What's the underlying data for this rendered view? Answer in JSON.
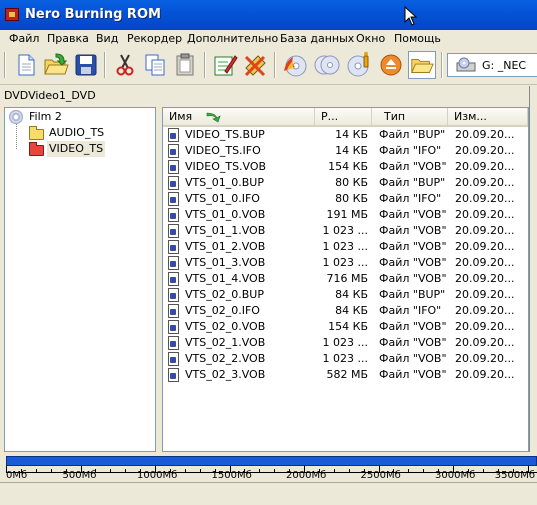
{
  "window": {
    "title": "Nero Burning ROM"
  },
  "menu": [
    "Файл",
    "Правка",
    "Вид",
    "Рекордер",
    "Дополнительно",
    "База данных",
    "Окно",
    "Помощь"
  ],
  "toolbar": {
    "buttons": [
      "new-document-icon",
      "open-icon",
      "save-icon",
      "cut-icon",
      "copy-icon",
      "paste-icon",
      "compilation-properties-icon",
      "erase-icon",
      "burn-icon",
      "copy-disc-icon",
      "disc-info-icon",
      "eject-icon",
      "open-folder-icon"
    ],
    "drive": {
      "label": "G: _NEC"
    }
  },
  "compilation": {
    "name": "DVDVideo1_DVD"
  },
  "tree": {
    "root": "Film 2",
    "children": [
      "AUDIO_TS",
      "VIDEO_TS"
    ]
  },
  "list": {
    "columns": [
      "Имя",
      "Р...",
      "Тип",
      "Изм..."
    ],
    "rows": [
      {
        "name": "VIDEO_TS.BUP",
        "size": "14 КБ",
        "type": "Файл \"BUP\"",
        "modified": "20.09.20..."
      },
      {
        "name": "VIDEO_TS.IFO",
        "size": "14 КБ",
        "type": "Файл \"IFO\"",
        "modified": "20.09.20..."
      },
      {
        "name": "VIDEO_TS.VOB",
        "size": "154 КБ",
        "type": "Файл \"VOB\"",
        "modified": "20.09.20..."
      },
      {
        "name": "VTS_01_0.BUP",
        "size": "80 КБ",
        "type": "Файл \"BUP\"",
        "modified": "20.09.20..."
      },
      {
        "name": "VTS_01_0.IFO",
        "size": "80 КБ",
        "type": "Файл \"IFO\"",
        "modified": "20.09.20..."
      },
      {
        "name": "VTS_01_0.VOB",
        "size": "191 МБ",
        "type": "Файл \"VOB\"",
        "modified": "20.09.20..."
      },
      {
        "name": "VTS_01_1.VOB",
        "size": "1 023 ...",
        "type": "Файл \"VOB\"",
        "modified": "20.09.20..."
      },
      {
        "name": "VTS_01_2.VOB",
        "size": "1 023 ...",
        "type": "Файл \"VOB\"",
        "modified": "20.09.20..."
      },
      {
        "name": "VTS_01_3.VOB",
        "size": "1 023 ...",
        "type": "Файл \"VOB\"",
        "modified": "20.09.20..."
      },
      {
        "name": "VTS_01_4.VOB",
        "size": "716 МБ",
        "type": "Файл \"VOB\"",
        "modified": "20.09.20..."
      },
      {
        "name": "VTS_02_0.BUP",
        "size": "84 КБ",
        "type": "Файл \"BUP\"",
        "modified": "20.09.20..."
      },
      {
        "name": "VTS_02_0.IFO",
        "size": "84 КБ",
        "type": "Файл \"IFO\"",
        "modified": "20.09.20..."
      },
      {
        "name": "VTS_02_0.VOB",
        "size": "154 КБ",
        "type": "Файл \"VOB\"",
        "modified": "20.09.20..."
      },
      {
        "name": "VTS_02_1.VOB",
        "size": "1 023 ...",
        "type": "Файл \"VOB\"",
        "modified": "20.09.20..."
      },
      {
        "name": "VTS_02_2.VOB",
        "size": "1 023 ...",
        "type": "Файл \"VOB\"",
        "modified": "20.09.20..."
      },
      {
        "name": "VTS_02_3.VOB",
        "size": "582 МБ",
        "type": "Файл \"VOB\"",
        "modified": "20.09.20..."
      }
    ]
  },
  "capacity": {
    "labels": [
      "0Мб",
      "500Мб",
      "1000Мб",
      "1500Мб",
      "2000Мб",
      "2500Мб",
      "3000Мб",
      "3500Мб"
    ]
  },
  "colors": {
    "titlebar": "#0454d8",
    "capacity_fill": "#1a5bd8",
    "selected_folder": "#e8463c"
  }
}
